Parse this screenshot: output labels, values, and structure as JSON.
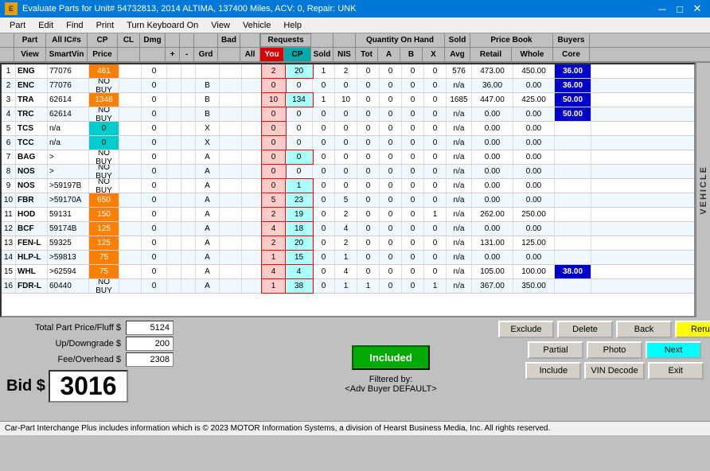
{
  "titleBar": {
    "icon": "E",
    "title": "Evaluate Parts for Unit# 54732813, 2014 ALTIMA, 137400 Miles, ACV: 0, Repair: UNK",
    "minimize": "─",
    "maximize": "□",
    "close": "✕"
  },
  "menuBar": {
    "items": [
      "Part",
      "Edit",
      "Find",
      "Print",
      "Turn Keyboard On",
      "View",
      "Vehicle",
      "Help"
    ]
  },
  "headers": {
    "row1": {
      "part": "Part",
      "allichs": "All IC#s",
      "cp": "CP",
      "cl": "CL",
      "dmg": "Dmg",
      "bad": "Bad",
      "requests": "Requests",
      "qoh": "Quantity On Hand",
      "sold": "Sold",
      "pricebook": "Price Book",
      "buyers": "Buyers"
    },
    "row2": {
      "view": "View",
      "smartvin": "SmartVin",
      "price": "Price",
      "plus": "+",
      "minus": "-",
      "grd": "Grd",
      "all": "All",
      "you": "You",
      "cp": "CP",
      "sold": "Sold",
      "nis": "NIS",
      "tot": "Tot",
      "a": "A",
      "b": "B",
      "x": "X",
      "avg": "Avg",
      "retail": "Retail",
      "whole": "Whole",
      "core": "Core"
    }
  },
  "rows": [
    {
      "num": "1",
      "part": "ENG",
      "allichs": "77076",
      "price": "461",
      "cl": "",
      "dmg": "0",
      "grd": "",
      "bad": "",
      "all": "",
      "you": "2",
      "cp": "20",
      "sold": "1",
      "nis": "2",
      "tot": "0",
      "a": "0",
      "b": "0",
      "x": "0",
      "soldavg": "576",
      "avg": "473.00",
      "retail": "450.00",
      "core": "36.00",
      "rowbg": "white",
      "pricebg": "orange",
      "youbg": "",
      "cpbg": "cyan",
      "corebg": "blue"
    },
    {
      "num": "2",
      "part": "ENC",
      "allichs": "77076",
      "price": "NO BUY",
      "cl": "",
      "dmg": "0",
      "grd": "B",
      "bad": "",
      "all": "",
      "you": "0",
      "cp": "0",
      "sold": "0",
      "nis": "0",
      "tot": "0",
      "a": "0",
      "b": "0",
      "x": "0",
      "soldavg": "n/a",
      "avg": "36.00",
      "retail": "0.00",
      "core": "36.00",
      "rowbg": "white",
      "pricebg": "",
      "youbg": "",
      "cpbg": "",
      "corebg": "blue"
    },
    {
      "num": "3",
      "part": "TRA",
      "allichs": "62614",
      "price": "1348",
      "cl": "",
      "dmg": "0",
      "grd": "B",
      "bad": "",
      "all": "",
      "you": "10",
      "cp": "134",
      "sold": "1",
      "nis": "10",
      "tot": "0",
      "a": "0",
      "b": "0",
      "x": "0",
      "soldavg": "1685",
      "avg": "447.00",
      "retail": "425.00",
      "core": "50.00",
      "rowbg": "white",
      "pricebg": "orange",
      "youbg": "",
      "cpbg": "cyan",
      "corebg": "blue"
    },
    {
      "num": "4",
      "part": "TRC",
      "allichs": "62614",
      "price": "NO BUY",
      "cl": "",
      "dmg": "0",
      "grd": "B",
      "bad": "",
      "all": "",
      "you": "0",
      "cp": "0",
      "sold": "0",
      "nis": "0",
      "tot": "0",
      "a": "0",
      "b": "0",
      "x": "0",
      "soldavg": "n/a",
      "avg": "0.00",
      "retail": "0.00",
      "core": "50.00",
      "rowbg": "white",
      "pricebg": "",
      "youbg": "",
      "cpbg": "",
      "corebg": "blue"
    },
    {
      "num": "5",
      "part": "TCS",
      "allichs": "n/a",
      "price": "0",
      "cl": "",
      "dmg": "0",
      "grd": "X",
      "bad": "",
      "all": "",
      "you": "0",
      "cp": "0",
      "sold": "0",
      "nis": "0",
      "tot": "0",
      "a": "0",
      "b": "0",
      "x": "0",
      "soldavg": "n/a",
      "avg": "0.00",
      "retail": "0.00",
      "core": "",
      "rowbg": "white",
      "pricebg": "cyan",
      "youbg": "",
      "cpbg": "",
      "corebg": ""
    },
    {
      "num": "6",
      "part": "TCC",
      "allichs": "n/a",
      "price": "0",
      "cl": "",
      "dmg": "0",
      "grd": "X",
      "bad": "",
      "all": "",
      "you": "0",
      "cp": "0",
      "sold": "0",
      "nis": "0",
      "tot": "0",
      "a": "0",
      "b": "0",
      "x": "0",
      "soldavg": "n/a",
      "avg": "0.00",
      "retail": "0.00",
      "core": "",
      "rowbg": "white",
      "pricebg": "cyan",
      "youbg": "",
      "cpbg": "",
      "corebg": ""
    },
    {
      "num": "7",
      "part": "BAG",
      "allichs": ">",
      "price": "NO BUY",
      "cl": "",
      "dmg": "0",
      "grd": "A",
      "bad": "",
      "all": "",
      "you": "0",
      "cp": "0",
      "sold": "0",
      "nis": "0",
      "tot": "0",
      "a": "0",
      "b": "0",
      "x": "0",
      "soldavg": "n/a",
      "avg": "0.00",
      "retail": "0.00",
      "core": "",
      "rowbg": "white",
      "pricebg": "",
      "youbg": "",
      "cpbg": "cyan",
      "corebg": ""
    },
    {
      "num": "8",
      "part": "NOS",
      "allichs": ">",
      "price": "NO BUY",
      "cl": "",
      "dmg": "0",
      "grd": "A",
      "bad": "",
      "all": "",
      "you": "0",
      "cp": "0",
      "sold": "0",
      "nis": "0",
      "tot": "0",
      "a": "0",
      "b": "0",
      "x": "0",
      "soldavg": "n/a",
      "avg": "0.00",
      "retail": "0.00",
      "core": "",
      "rowbg": "white",
      "pricebg": "",
      "youbg": "",
      "cpbg": "",
      "corebg": ""
    },
    {
      "num": "9",
      "part": "NOS",
      "allichs": ">59197B",
      "price": "NO BUY",
      "cl": "",
      "dmg": "0",
      "grd": "A",
      "bad": "",
      "all": "",
      "you": "0",
      "cp": "1",
      "sold": "0",
      "nis": "0",
      "tot": "0",
      "a": "0",
      "b": "0",
      "x": "0",
      "soldavg": "n/a",
      "avg": "0.00",
      "retail": "0.00",
      "core": "",
      "rowbg": "white",
      "pricebg": "",
      "youbg": "",
      "cpbg": "",
      "corebg": ""
    },
    {
      "num": "10",
      "part": "FBR",
      "allichs": ">59170A",
      "price": "650",
      "cl": "",
      "dmg": "0",
      "grd": "A",
      "bad": "",
      "all": "",
      "you": "5",
      "cp": "23",
      "sold": "0",
      "nis": "5",
      "tot": "0",
      "a": "0",
      "b": "0",
      "x": "0",
      "soldavg": "n/a",
      "avg": "0.00",
      "retail": "0.00",
      "core": "",
      "rowbg": "white",
      "pricebg": "orange",
      "youbg": "",
      "cpbg": "cyan",
      "corebg": ""
    },
    {
      "num": "11",
      "part": "HOD",
      "allichs": "59131",
      "price": "150",
      "cl": "",
      "dmg": "0",
      "grd": "A",
      "bad": "",
      "all": "",
      "you": "2",
      "cp": "19",
      "sold": "0",
      "nis": "2",
      "tot": "0",
      "a": "0",
      "b": "0",
      "x": "1",
      "soldavg": "n/a",
      "avg": "262.00",
      "retail": "250.00",
      "core": "",
      "rowbg": "white",
      "pricebg": "orange",
      "youbg": "",
      "cpbg": "cyan",
      "corebg": ""
    },
    {
      "num": "12",
      "part": "BCF",
      "allichs": "59174B",
      "price": "125",
      "cl": "",
      "dmg": "0",
      "grd": "A",
      "bad": "",
      "all": "",
      "you": "4",
      "cp": "18",
      "sold": "0",
      "nis": "4",
      "tot": "0",
      "a": "0",
      "b": "0",
      "x": "0",
      "soldavg": "n/a",
      "avg": "0.00",
      "retail": "0.00",
      "core": "",
      "rowbg": "white",
      "pricebg": "orange",
      "youbg": "",
      "cpbg": "cyan",
      "corebg": ""
    },
    {
      "num": "13",
      "part": "FEN-L",
      "allichs": "59325",
      "price": "125",
      "cl": "",
      "dmg": "0",
      "grd": "A",
      "bad": "",
      "all": "",
      "you": "2",
      "cp": "20",
      "sold": "0",
      "nis": "2",
      "tot": "0",
      "a": "0",
      "b": "0",
      "x": "0",
      "soldavg": "n/a",
      "avg": "131.00",
      "retail": "125.00",
      "core": "",
      "rowbg": "white",
      "pricebg": "orange",
      "youbg": "",
      "cpbg": "cyan",
      "corebg": ""
    },
    {
      "num": "14",
      "part": "HLP-L",
      "allichs": ">59813",
      "price": "75",
      "cl": "",
      "dmg": "0",
      "grd": "A",
      "bad": "",
      "all": "",
      "you": "1",
      "cp": "15",
      "sold": "0",
      "nis": "1",
      "tot": "0",
      "a": "0",
      "b": "0",
      "x": "0",
      "soldavg": "n/a",
      "avg": "0.00",
      "retail": "0.00",
      "core": "",
      "rowbg": "white",
      "pricebg": "orange",
      "youbg": "",
      "cpbg": "cyan",
      "corebg": ""
    },
    {
      "num": "15",
      "part": "WHL",
      "allichs": ">62594",
      "price": "75",
      "cl": "",
      "dmg": "0",
      "grd": "A",
      "bad": "",
      "all": "",
      "you": "4",
      "cp": "4",
      "sold": "0",
      "nis": "4",
      "tot": "0",
      "a": "0",
      "b": "0",
      "x": "0",
      "soldavg": "n/a",
      "avg": "105.00",
      "retail": "100.00",
      "core": "38.00",
      "rowbg": "white",
      "pricebg": "orange",
      "youbg": "",
      "cpbg": "cyan",
      "corebg": "blue"
    },
    {
      "num": "16",
      "part": "FDR-L",
      "allichs": "60440",
      "price": "NO BUY",
      "cl": "",
      "dmg": "0",
      "grd": "A",
      "bad": "",
      "all": "",
      "you": "1",
      "cp": "38",
      "sold": "0",
      "nis": "1",
      "tot": "1",
      "a": "0",
      "b": "0",
      "x": "1",
      "soldavg": "n/a",
      "avg": "367.00",
      "retail": "350.00",
      "core": "",
      "rowbg": "white",
      "pricebg": "",
      "youbg": "",
      "cpbg": "cyan",
      "corebg": ""
    }
  ],
  "bottomLeft": {
    "totalLabel": "Total Part Price/Fluff $",
    "totalValue": "5124",
    "updownLabel": "Up/Downgrade $",
    "updownValue": "200",
    "feeLabel": "Fee/Overhead $",
    "feeValue": "2308",
    "bidLabel": "Bid $",
    "bidValue": "3016"
  },
  "bottomMid": {
    "includedLabel": "Included",
    "filteredBy": "Filtered by:",
    "filterValue": "<Adv Buyer DEFAULT>"
  },
  "bottomRight": {
    "buttons": [
      {
        "label": "Exclude",
        "style": "normal"
      },
      {
        "label": "Delete",
        "style": "normal"
      },
      {
        "label": "Back",
        "style": "normal"
      },
      {
        "label": "Rerun",
        "style": "yellow"
      },
      {
        "label": "Partial",
        "style": "normal"
      },
      {
        "label": "Photo",
        "style": "normal"
      },
      {
        "label": "Next",
        "style": "cyan"
      },
      {
        "label": "Include",
        "style": "normal"
      },
      {
        "label": "VIN Decode",
        "style": "normal"
      },
      {
        "label": "Exit",
        "style": "normal"
      }
    ]
  },
  "statusBar": {
    "text": "Car-Part Interchange Plus includes information which is © 2023 MOTOR Information Systems, a division of Hearst Business Media, Inc.   All rights reserved."
  },
  "vehiclePanel": "VEHICLE"
}
